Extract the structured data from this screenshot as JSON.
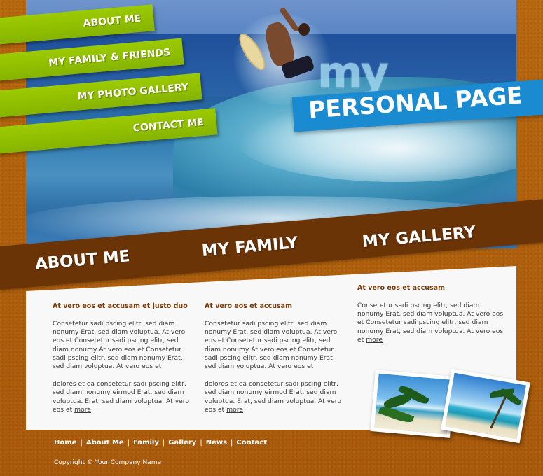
{
  "nav": {
    "items": [
      {
        "label": "ABOUT ME"
      },
      {
        "label": "MY FAMILY & FRIENDS"
      },
      {
        "label": "MY PHOTO GALLERY"
      },
      {
        "label": "CONTACT ME"
      }
    ]
  },
  "logo": {
    "my": "my",
    "title": "PERSONAL PAGE"
  },
  "band": {
    "headings": [
      "ABOUT ME",
      "MY FAMILY",
      "MY GALLERY"
    ]
  },
  "columns": [
    {
      "heading": "At vero eos et accusam et justo duo",
      "para1": "Consetetur sadi pscing elitr, sed diam nonumy Erat, sed diam voluptua. At vero eos et Consetetur sadi pscing elitr, sed diam nonumy At vero eos et Consetetur sadi pscing elitr, sed diam nonumy Erat, sed diam voluptua. At vero eos et",
      "para2": "dolores et ea consetetur sadi pscing elitr, sed diam nonumy eirmod Erat, sed diam voluptua. Erat, sed diam voluptua. At vero eos et",
      "more": "more"
    },
    {
      "heading": "At vero eos et accusam",
      "para1": "Consetetur sadi pscing elitr, sed diam nonumy Erat, sed diam voluptua. At vero eos et Consetetur sadi pscing elitr, sed diam nonumy At vero eos et Consetetur sadi pscing elitr, sed diam nonumy Erat, sed diam voluptua. At vero eos et",
      "para2": "dolores et ea consetetur sadi pscing elitr, sed diam nonumy eirmod Erat, sed diam voluptua. Erat, sed diam voluptua. At vero eos et",
      "more": "more"
    },
    {
      "heading": "At vero eos et accusam",
      "para1": "Consetetur sadi pscing elitr, sed diam nonumy Erat, sed diam voluptua. At vero eos et Consetetur sadi pscing elitr, sed diam nonumy Erat, sed diam voluptua. At vero eos et",
      "more": "more"
    }
  ],
  "footer": {
    "links": [
      "Home",
      "About Me",
      "Family",
      "Gallery",
      "News",
      "Contact"
    ],
    "copyright": "Copyright © Your Company Name"
  },
  "colors": {
    "nav_green": "#9ccb00",
    "band_brown": "#6b3407",
    "logo_blue": "#1a8bd0",
    "page_orange": "#b0620f"
  }
}
